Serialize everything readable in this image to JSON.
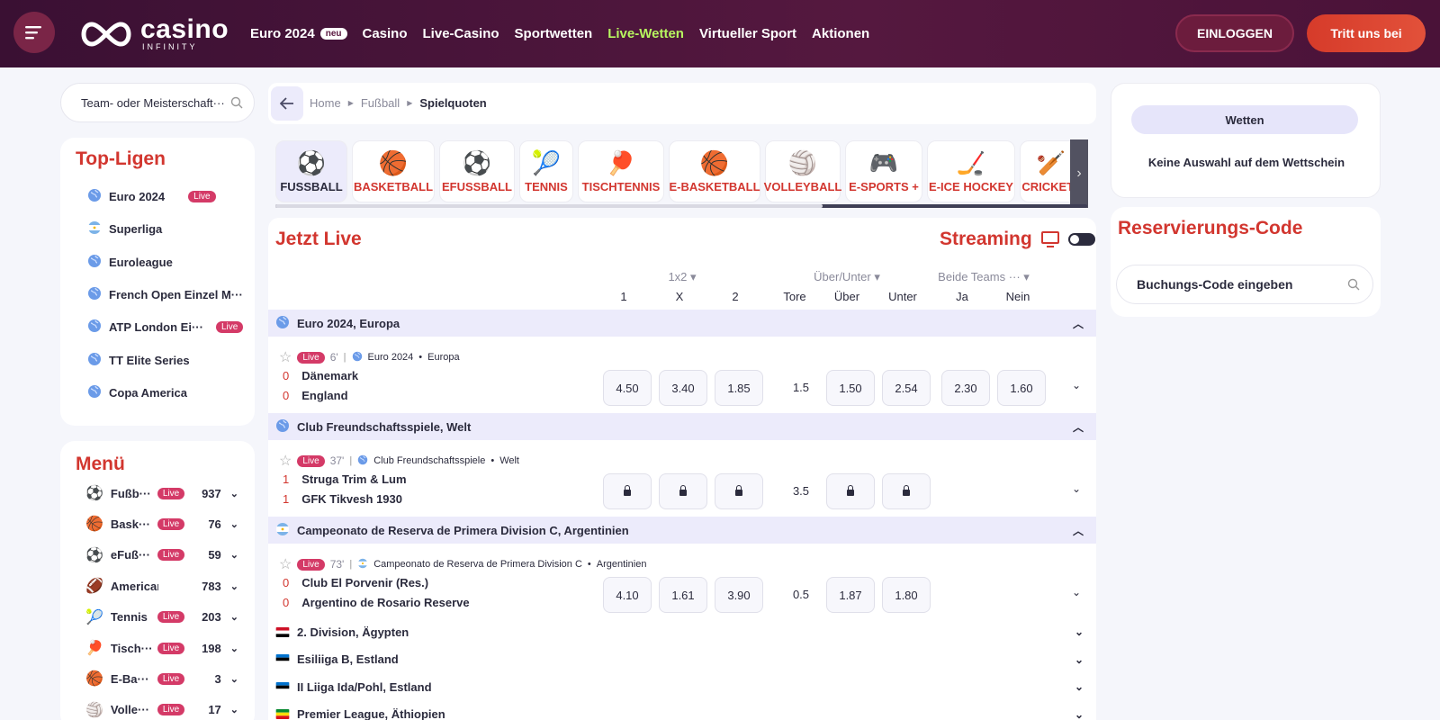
{
  "header": {
    "logo_name": "casino",
    "logo_sub": "INFINITY",
    "nav": [
      {
        "label": "Euro 2024",
        "badge": "neu"
      },
      {
        "label": "Casino"
      },
      {
        "label": "Live-Casino"
      },
      {
        "label": "Sportwetten"
      },
      {
        "label": "Live-Wetten",
        "active": true
      },
      {
        "label": "Virtueller Sport"
      },
      {
        "label": "Aktionen"
      }
    ],
    "login": "EINLOGGEN",
    "join": "Tritt uns bei",
    "accent_active": "#b7f560"
  },
  "search": {
    "placeholder": "Team- oder Meisterschaft···"
  },
  "top_ligen": {
    "title": "Top-Ligen",
    "items": [
      {
        "label": "Euro 2024",
        "live": "Live",
        "icon": "globe-icon"
      },
      {
        "label": "Superliga",
        "icon": "argentina-flag-icon"
      },
      {
        "label": "Euroleague",
        "icon": "globe-icon"
      },
      {
        "label": "French Open Einzel M···",
        "icon": "globe-icon"
      },
      {
        "label": "ATP London Ei···",
        "live": "Live",
        "icon": "globe-icon"
      },
      {
        "label": "TT Elite Series",
        "icon": "globe-icon"
      },
      {
        "label": "Copa America",
        "icon": "globe-icon"
      }
    ]
  },
  "menu": {
    "title": "Menü",
    "items": [
      {
        "label": "Fußb···",
        "live": "Live",
        "count": "937",
        "icon": "⚽"
      },
      {
        "label": "Bask···",
        "live": "Live",
        "count": "76",
        "icon": "🏀"
      },
      {
        "label": "eFuß···",
        "live": "Live",
        "count": "59",
        "icon": "⚽"
      },
      {
        "label": "American Fo···",
        "count": "783",
        "icon": "🏈"
      },
      {
        "label": "Tennis",
        "live": "Live",
        "count": "203",
        "icon": "🎾"
      },
      {
        "label": "Tisch···",
        "live": "Live",
        "count": "198",
        "icon": "🏓"
      },
      {
        "label": "E-Ba···",
        "live": "Live",
        "count": "3",
        "icon": "🏀"
      },
      {
        "label": "Volle···",
        "live": "Live",
        "count": "17",
        "icon": "🏐"
      }
    ]
  },
  "breadcrumb": {
    "items": [
      "Home",
      "Fußball"
    ],
    "current": "Spielquoten"
  },
  "sports_tabs": [
    {
      "label": "FUSSBALL",
      "icon": "⚽",
      "selected": true
    },
    {
      "label": "BASKETBALL",
      "icon": "🏀"
    },
    {
      "label": "EFUSSBALL",
      "icon": "⚽"
    },
    {
      "label": "TENNIS",
      "icon": "🎾"
    },
    {
      "label": "TISCHTENNIS",
      "icon": "🏓"
    },
    {
      "label": "E-BASKETBALL",
      "icon": "🏀"
    },
    {
      "label": "VOLLEYBALL",
      "icon": "🏐"
    },
    {
      "label": "E-SPORTS +",
      "icon": "🎮"
    },
    {
      "label": "E-ICE HOCKEY",
      "icon": "🏒"
    },
    {
      "label": "CRICKET+",
      "icon": "🏏"
    }
  ],
  "live": {
    "title": "Jetzt Live",
    "streaming": "Streaming",
    "col_groups": [
      "1x2",
      "Über/Unter",
      "Beide Teams ···"
    ],
    "cols": [
      "1",
      "X",
      "2",
      "Tore",
      "Über",
      "Unter",
      "Ja",
      "Nein"
    ],
    "groups": [
      {
        "name": "Euro 2024, Europa",
        "match": {
          "live": "Live",
          "minute": "6'",
          "league": "Euro 2024",
          "region": "Europa",
          "home": {
            "score": "0",
            "name": "Dänemark"
          },
          "away": {
            "score": "0",
            "name": "England"
          },
          "odds": [
            "4.50",
            "3.40",
            "1.85",
            "1.5",
            "1.50",
            "2.54",
            "2.30",
            "1.60"
          ]
        }
      },
      {
        "name": "Club Freundschaftsspiele, Welt",
        "match": {
          "live": "Live",
          "minute": "37'",
          "league": "Club Freundschaftsspiele",
          "region": "Welt",
          "home": {
            "score": "1",
            "name": "Struga Trim & Lum"
          },
          "away": {
            "score": "1",
            "name": "GFK Tikvesh 1930"
          },
          "odds": [
            "locked",
            "locked",
            "locked",
            "3.5",
            "locked",
            "locked"
          ]
        }
      },
      {
        "name": "Campeonato de Reserva de Primera Division C, Argentinien",
        "match": {
          "live": "Live",
          "minute": "73'",
          "league": "Campeonato de Reserva de Primera Division C",
          "region": "Argentinien",
          "home": {
            "score": "0",
            "name": "Club El Porvenir (Res.)"
          },
          "away": {
            "score": "0",
            "name": "Argentino de Rosario Reserve"
          },
          "odds": [
            "4.10",
            "1.61",
            "3.90",
            "0.5",
            "1.87",
            "1.80"
          ]
        }
      }
    ],
    "collapsed": [
      "2. Division, Ägypten",
      "Esiliiga B, Estland",
      "II Liiga Ida/Pohl, Estland",
      "Premier League, Äthiopien"
    ]
  },
  "betslip": {
    "tab": "Wetten",
    "empty": "Keine Auswahl auf dem Wettschein"
  },
  "reservation": {
    "title": "Reservierungs-Code",
    "placeholder": "Buchungs-Code eingeben"
  }
}
